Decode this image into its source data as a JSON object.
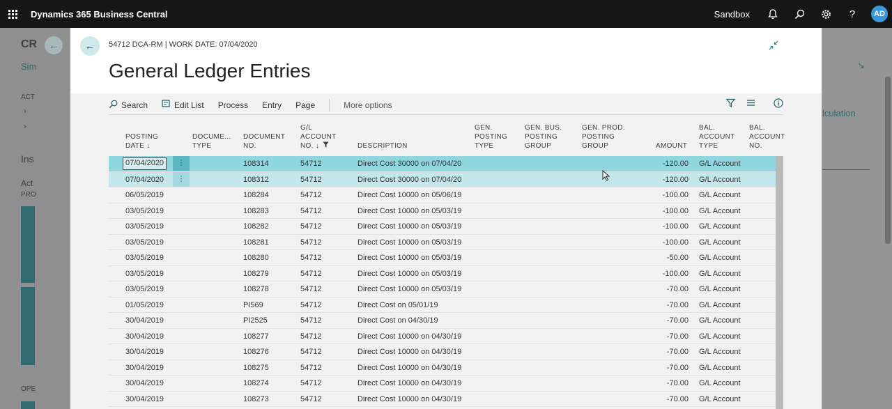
{
  "appbar": {
    "title": "Dynamics 365 Business Central",
    "environment": "Sandbox",
    "avatar_initials": "AD",
    "icons": [
      "waffle-icon",
      "bell-icon",
      "search-icon",
      "gear-icon",
      "help-icon"
    ]
  },
  "background": {
    "left_title": "CR",
    "left_link": "Sim",
    "left_acts": "ACT",
    "left_ins": "Ins",
    "left_act2": "Act",
    "left_pro": "PRO",
    "left_ope": "OPE",
    "right_link": "lculation"
  },
  "dialog": {
    "caption": "54712 DCA-RM | WORK DATE: 07/04/2020",
    "title": "General Ledger Entries",
    "toolbar": {
      "search": "Search",
      "edit_list": "Edit List",
      "process": "Process",
      "entry": "Entry",
      "page": "Page",
      "more": "More options"
    },
    "columns": {
      "posting_date": [
        "POSTING",
        "DATE ↓"
      ],
      "document_type": [
        "DOCUME...",
        "TYPE"
      ],
      "document_no": [
        "DOCUMENT",
        "NO."
      ],
      "gl_account_no": [
        "G/L",
        "ACCOUNT",
        "NO. ↓"
      ],
      "description": [
        "DESCRIPTION"
      ],
      "gen_posting_type": [
        "GEN.",
        "POSTING",
        "TYPE"
      ],
      "gen_bus_posting_group": [
        "GEN. BUS.",
        "POSTING",
        "GROUP"
      ],
      "gen_prod_posting_group": [
        "GEN. PROD.",
        "POSTING",
        "GROUP"
      ],
      "amount": [
        "AMOUNT"
      ],
      "bal_account_type": [
        "BAL.",
        "ACCOUNT",
        "TYPE"
      ],
      "bal_account_no": [
        "BAL.",
        "ACCOUNT",
        "NO."
      ]
    },
    "rows": [
      {
        "date": "07/04/2020",
        "doc": "108314",
        "acc": "54712",
        "desc": "Direct Cost 30000 on 07/04/20",
        "amount": "-120.00",
        "bal_type": "G/L Account"
      },
      {
        "date": "07/04/2020",
        "doc": "108312",
        "acc": "54712",
        "desc": "Direct Cost 30000 on 07/04/20",
        "amount": "-120.00",
        "bal_type": "G/L Account"
      },
      {
        "date": "06/05/2019",
        "doc": "108284",
        "acc": "54712",
        "desc": "Direct Cost 10000 on 05/06/19",
        "amount": "-100.00",
        "bal_type": "G/L Account"
      },
      {
        "date": "03/05/2019",
        "doc": "108283",
        "acc": "54712",
        "desc": "Direct Cost 10000 on 05/03/19",
        "amount": "-100.00",
        "bal_type": "G/L Account"
      },
      {
        "date": "03/05/2019",
        "doc": "108282",
        "acc": "54712",
        "desc": "Direct Cost 10000 on 05/03/19",
        "amount": "-100.00",
        "bal_type": "G/L Account"
      },
      {
        "date": "03/05/2019",
        "doc": "108281",
        "acc": "54712",
        "desc": "Direct Cost 10000 on 05/03/19",
        "amount": "-100.00",
        "bal_type": "G/L Account"
      },
      {
        "date": "03/05/2019",
        "doc": "108280",
        "acc": "54712",
        "desc": "Direct Cost 10000 on 05/03/19",
        "amount": "-50.00",
        "bal_type": "G/L Account"
      },
      {
        "date": "03/05/2019",
        "doc": "108279",
        "acc": "54712",
        "desc": "Direct Cost 10000 on 05/03/19",
        "amount": "-100.00",
        "bal_type": "G/L Account"
      },
      {
        "date": "03/05/2019",
        "doc": "108278",
        "acc": "54712",
        "desc": "Direct Cost 10000 on 05/03/19",
        "amount": "-70.00",
        "bal_type": "G/L Account"
      },
      {
        "date": "01/05/2019",
        "doc": "PI569",
        "acc": "54712",
        "desc": "Direct Cost on 05/01/19",
        "amount": "-70.00",
        "bal_type": "G/L Account"
      },
      {
        "date": "30/04/2019",
        "doc": "PI2525",
        "acc": "54712",
        "desc": "Direct Cost on 04/30/19",
        "amount": "-70.00",
        "bal_type": "G/L Account"
      },
      {
        "date": "30/04/2019",
        "doc": "108277",
        "acc": "54712",
        "desc": "Direct Cost 10000 on 04/30/19",
        "amount": "-70.00",
        "bal_type": "G/L Account"
      },
      {
        "date": "30/04/2019",
        "doc": "108276",
        "acc": "54712",
        "desc": "Direct Cost 10000 on 04/30/19",
        "amount": "-70.00",
        "bal_type": "G/L Account"
      },
      {
        "date": "30/04/2019",
        "doc": "108275",
        "acc": "54712",
        "desc": "Direct Cost 10000 on 04/30/19",
        "amount": "-70.00",
        "bal_type": "G/L Account"
      },
      {
        "date": "30/04/2019",
        "doc": "108274",
        "acc": "54712",
        "desc": "Direct Cost 10000 on 04/30/19",
        "amount": "-70.00",
        "bal_type": "G/L Account"
      },
      {
        "date": "30/04/2019",
        "doc": "108273",
        "acc": "54712",
        "desc": "Direct Cost 10000 on 04/30/19",
        "amount": "-70.00",
        "bal_type": "G/L Account"
      }
    ],
    "selected_row_index": 0
  },
  "colors": {
    "appbar": "#161616",
    "accent": "#1d5d63",
    "selected_row": "#8fd6df",
    "secondary_row": "#c3e7ec",
    "avatar": "#3a96dd"
  }
}
